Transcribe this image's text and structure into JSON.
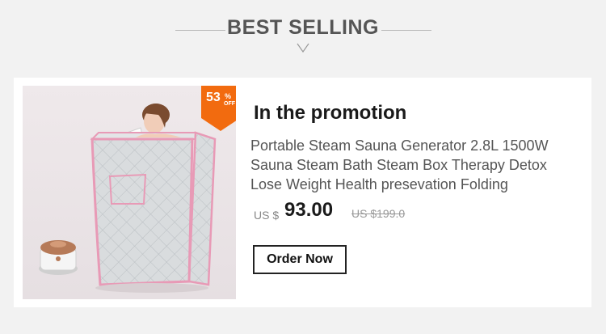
{
  "header": {
    "title": "BEST SELLING"
  },
  "product": {
    "discount_number": "53",
    "discount_percent": "%",
    "discount_off": "OFF",
    "promo_heading": "In the promotion",
    "name": "Portable Steam Sauna Generator 2.8L 1500W Sauna Steam Bath Steam Box Therapy Detox Lose Weight Health presevation Folding",
    "currency_label": "US $",
    "price": "93.00",
    "original_price": "US $199.0",
    "order_button_label": "Order Now",
    "image_subject": "portable-steam-sauna-photo"
  },
  "colors": {
    "background": "#f2f2f2",
    "card": "#ffffff",
    "badge": "#f26b0f",
    "sauna_trim": "#e89ab6",
    "sauna_fabric": "#d9dcde"
  }
}
